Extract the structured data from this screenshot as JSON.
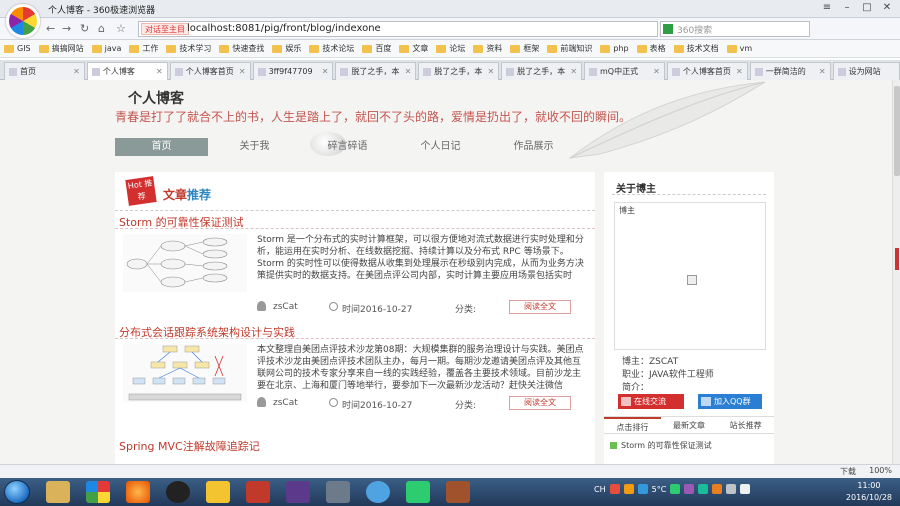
{
  "browser": {
    "window_title": "个人博客 - 360极速浏览器",
    "address_tag": "对话至主目",
    "url": "localhost:8081/pig/front/blog/indexone",
    "search_placeholder": "360搜索",
    "bookmarks": [
      "GIS",
      "搞搞网站",
      "java",
      "工作",
      "技术学习",
      "快速查找",
      "娱乐",
      "技术论坛",
      "百度",
      "文章",
      "论坛",
      "资料",
      "框架",
      "前端知识",
      "php",
      "表格",
      "技术文档",
      "vm"
    ],
    "tabs": [
      {
        "label": "首页",
        "active": false
      },
      {
        "label": "个人博客",
        "active": true
      },
      {
        "label": "个人博客首页",
        "active": false
      },
      {
        "label": "3ff9f47709",
        "active": false
      },
      {
        "label": "脱了之手，本",
        "active": false
      },
      {
        "label": "脱了之手，本",
        "active": false
      },
      {
        "label": "脱了之手，本",
        "active": false
      },
      {
        "label": "mQ中正式",
        "active": false
      },
      {
        "label": "个人博客首页",
        "active": false
      },
      {
        "label": "一群简洁的",
        "active": false
      },
      {
        "label": "设为网站",
        "active": false
      }
    ],
    "status_download": "下载",
    "zoom": "100%"
  },
  "blog": {
    "title": "个人博客",
    "motto": "青春是打了了就合不上的书，人生是踏上了，就回不了头的路，爱情是扔出了，就收不回的瞬间。",
    "menu": [
      {
        "label": "首页",
        "active": true
      },
      {
        "label": "关于我",
        "active": false
      },
      {
        "label": "碎言碎语",
        "active": false
      },
      {
        "label": "个人日记",
        "active": false
      },
      {
        "label": "作品展示",
        "active": false
      }
    ],
    "hot_badge": "Hot 推荐",
    "section_title_a": "文章",
    "section_title_b": "推荐",
    "articles": [
      {
        "title": "Storm 的可靠性保证测试",
        "summary": "Storm 是一个分布式的实时计算框架，可以很方便地对流式数据进行实时处理和分析，能运用在实时分析、在线数据挖掘、持续计算以及分布式 RPC 等场景下。Storm 的实时性可以使得数据从收集到处理展示在秒级别内完成，从而为业务方决策提供实时的数据支持。在美团点评公司内部，实时计算主要应用场景包括实时",
        "author": "zsCat",
        "time": "时间2016-10-27",
        "category": "分类:",
        "read_label": "阅读全文"
      },
      {
        "title": "分布式会话跟踪系统架构设计与实践",
        "summary": "本文整理自美团点评技术沙龙第08期：大规模集群的服务治理设计与实践。美团点评技术沙龙由美团点评技术团队主办，每月一期。每期沙龙邀请美团点评及其他互联网公司的技术专家分享来自一线的实践经验，覆盖各主要技术领域。目前沙龙主要在北京、上海和厦门等地举行，要参加下一次最新沙龙活动？赶快关注微信",
        "author": "zsCat",
        "time": "时间2016-10-27",
        "category": "分类:",
        "read_label": "阅读全文"
      },
      {
        "title": "Spring MVC注解故障追踪记"
      }
    ],
    "sidebar": {
      "about_title": "关于博主",
      "avatar_label": "博主",
      "name_line": "博主：ZSCAT",
      "job_line": "职业：JAVA软件工程师",
      "intro_line": "简介：",
      "mail_button": "在线交流",
      "qq_button": "加入QQ群",
      "tabs": [
        {
          "label": "点击排行",
          "active": true
        },
        {
          "label": "最新文章",
          "active": false
        },
        {
          "label": "站长推荐",
          "active": false
        }
      ],
      "list_item": "Storm 的可靠性保证测试"
    }
  },
  "taskbar": {
    "tray_lang": "CH",
    "tray_temp": "5°C",
    "time": "11:00",
    "date": "2016/10/28"
  },
  "colors": {
    "accent_red": "#c0392b",
    "motto_color": "#c45550",
    "menu_active": "#8a9a99"
  }
}
